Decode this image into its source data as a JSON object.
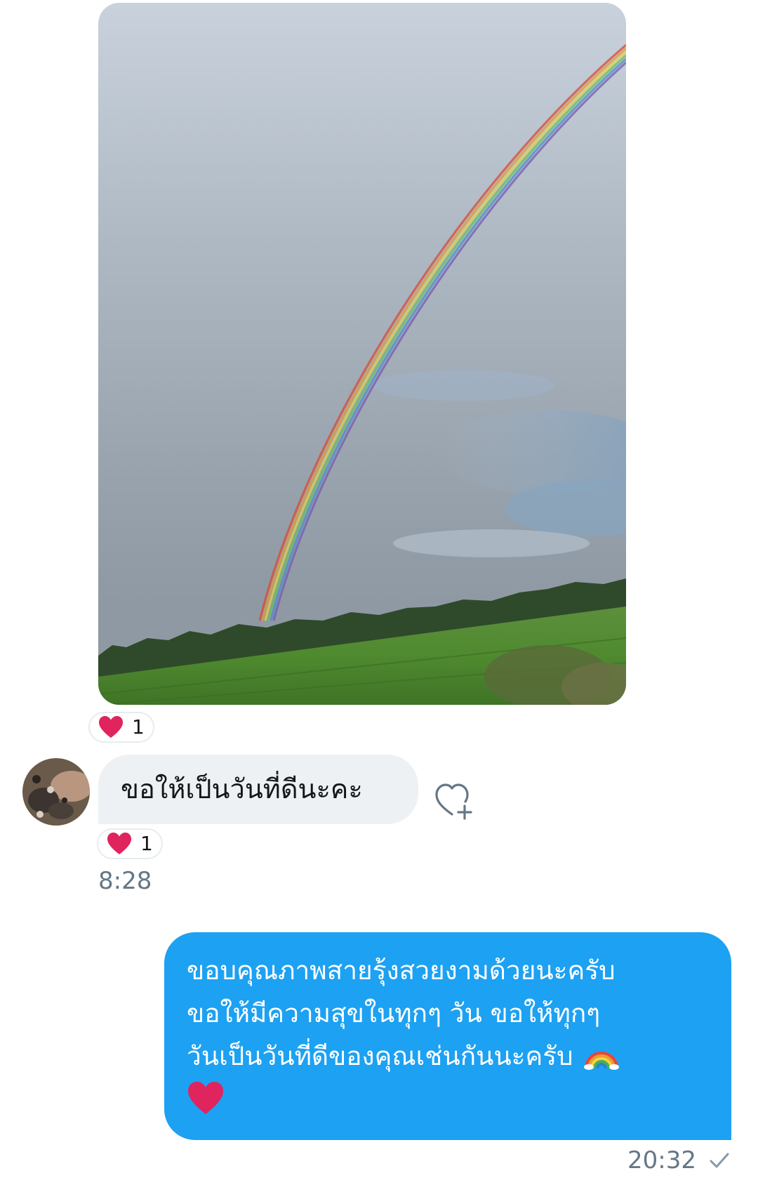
{
  "photo_message": {
    "image": "rainbow-over-rice-field",
    "reaction": {
      "emoji": "heart",
      "count": "1"
    }
  },
  "received_message": {
    "avatar": "contact-avatar",
    "text": "ขอให้เป็นวันที่ดีนะคะ",
    "reaction": {
      "emoji": "heart",
      "count": "1"
    },
    "time": "8:28"
  },
  "sent_message": {
    "lines": [
      "ขอบคุณภาพสายรุ้งสวยงามด้วยนะครับ",
      "ขอให้มีความสุขในทุกๆ วัน ขอให้ทุกๆ",
      "วันเป็นวันที่ดีของคุณเช่นกันนะครับ"
    ],
    "emojis": [
      "rainbow-icon",
      "heart-icon"
    ],
    "time": "20:32",
    "status_icon": "check-icon"
  },
  "colors": {
    "sent_bubble": "#1da1f2",
    "received_bubble": "#eef1f3",
    "heart": "#e0245e",
    "timestamp": "#657786"
  }
}
